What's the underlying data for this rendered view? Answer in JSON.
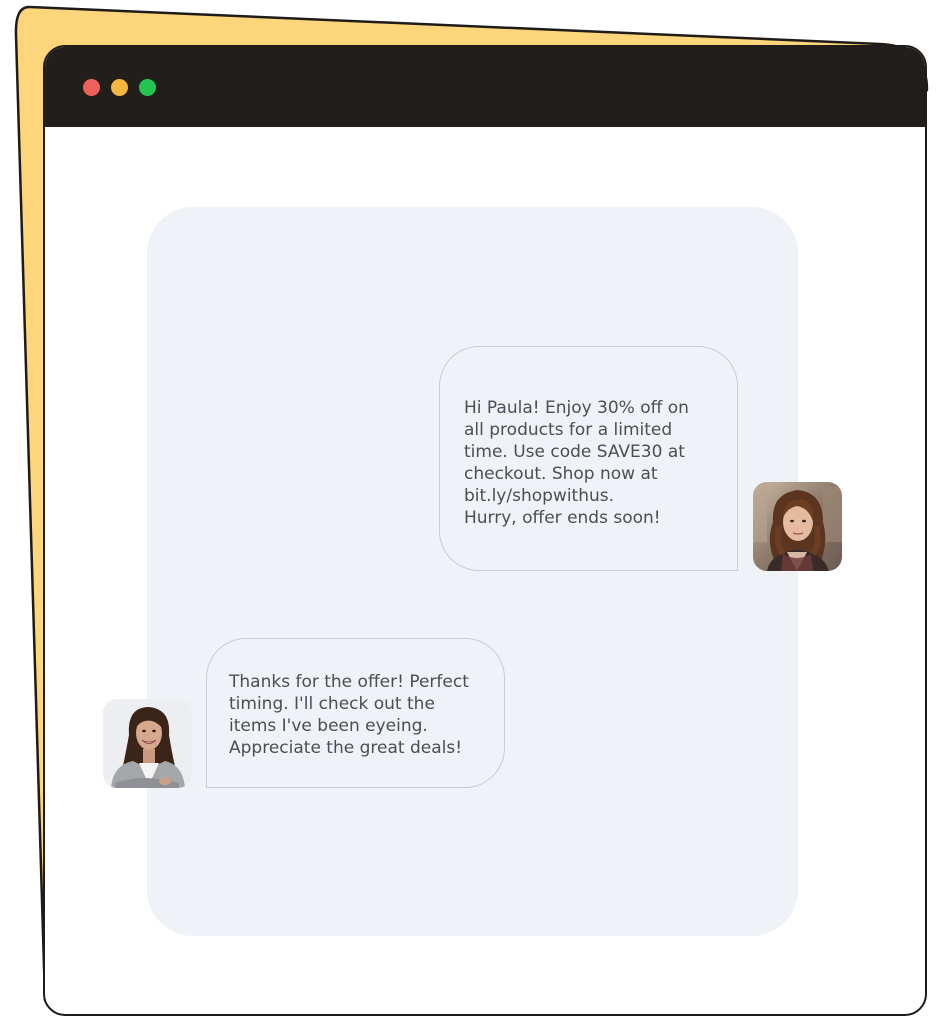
{
  "window": {
    "controls": [
      "close",
      "minimize",
      "maximize"
    ],
    "colors": {
      "backing": "#fdd57a",
      "titlebar": "#221e1c",
      "close": "#f0605a",
      "minimize": "#f5b53f",
      "maximize": "#23c552",
      "chat_background": "#eff2f7"
    }
  },
  "chat": {
    "messages": [
      {
        "direction": "outgoing",
        "text": "Hi Paula! Enjoy 30% off on\nall products for a limited\ntime. Use code SAVE30 at\ncheckout. Shop now at\nbit.ly/shopwithus.\nHurry, offer ends soon!",
        "avatar": "woman-with-wavy-brown-hair-photo"
      },
      {
        "direction": "incoming",
        "text": "Thanks for the offer! Perfect\ntiming. I'll check out the\nitems I've been eyeing.\nAppreciate the great deals!",
        "avatar": "smiling-woman-in-grey-blazer-photo"
      }
    ]
  }
}
